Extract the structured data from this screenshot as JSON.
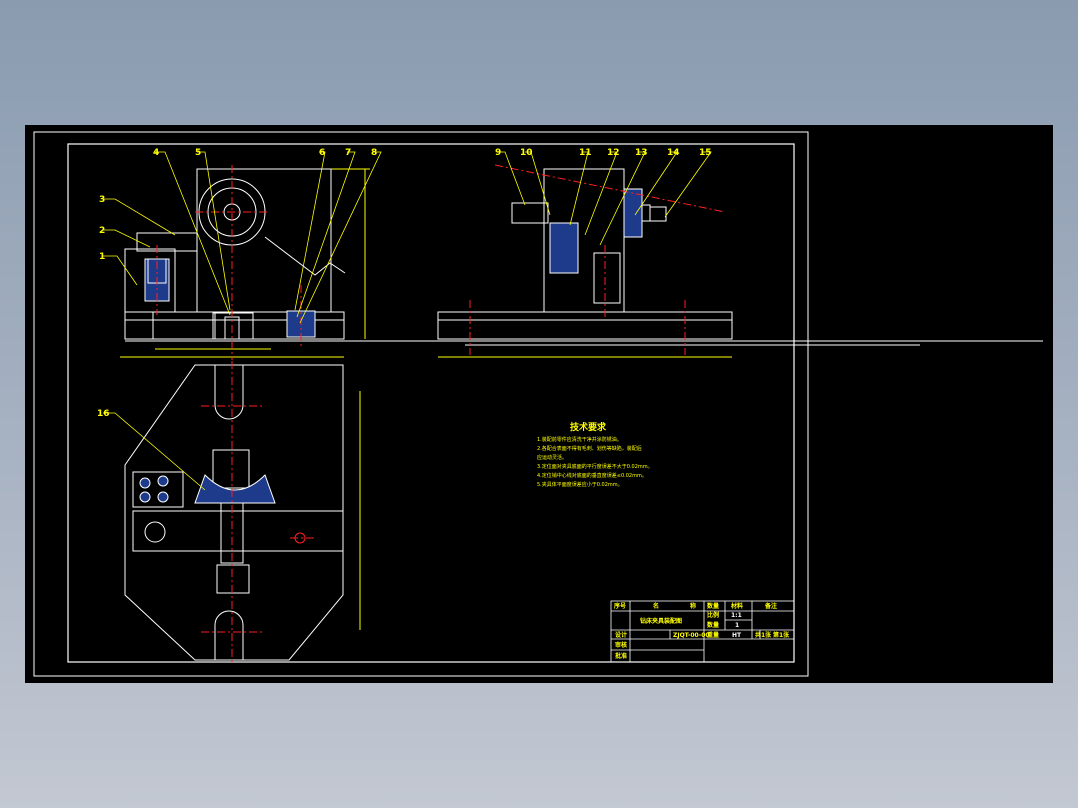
{
  "balloons": {
    "b1": "1",
    "b2": "2",
    "b3": "3",
    "b4": "4",
    "b5": "5",
    "b6": "6",
    "b7": "7",
    "b8": "8",
    "b9": "9",
    "b10": "10",
    "b11": "11",
    "b12": "12",
    "b13": "13",
    "b14": "14",
    "b15": "15",
    "b16": "16"
  },
  "tech": {
    "title": "技术要求",
    "lines": [
      "1.装配前零件应清洗干净并涂防锈油。",
      "2.各配合表面不得有毛刺、划伤等缺陷，装配后",
      "应运动灵活。",
      "3.定位面对夹具底面的平行度误差不大于0.02mm。",
      "4.定位销中心线对底面的垂直度误差≤0.02mm。",
      "5.夹具体平面度误差应小于0.02mm。"
    ]
  },
  "title_block": {
    "h1": "序号",
    "h2": "名",
    "h3": "称",
    "h4": "数量",
    "h5": "材料",
    "h6": "备注",
    "name": "钻床夹具装配图",
    "scale_label": "比例",
    "scale_value": "1:1",
    "qty_label": "数量",
    "qty_value": "1",
    "design": "设计",
    "drawno": "ZJQT-00-00",
    "weight_label": "重量",
    "material": "HT",
    "sheet": "共1张",
    "sheet2": "第1张",
    "check": "审核",
    "approve": "批准"
  },
  "colors": {
    "line": "#ffffff",
    "yellow": "#ffff00",
    "red": "#ff2020",
    "fill": "#1e3a8a"
  }
}
